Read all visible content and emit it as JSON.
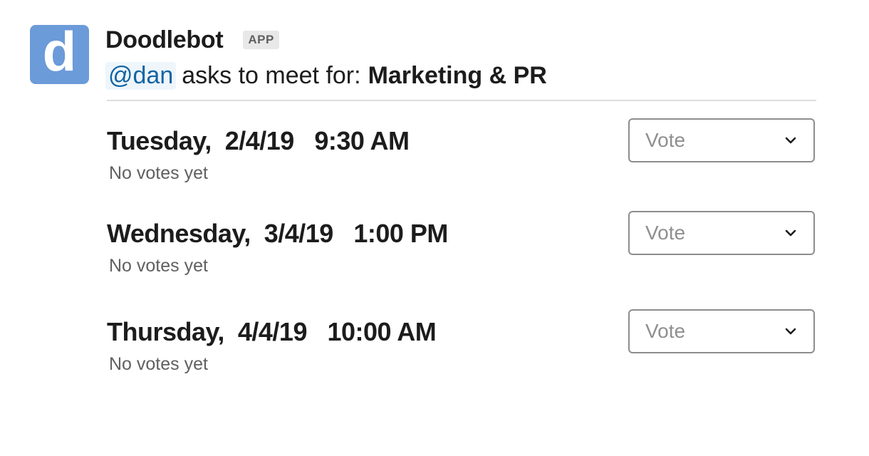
{
  "bot": {
    "avatar_letter": "d",
    "avatar_color": "#6b9bd8",
    "name": "Doodlebot",
    "badge": "APP"
  },
  "message": {
    "mention": "@dan",
    "text": "asks to meet for:",
    "meeting_title": "Marketing & PR"
  },
  "options": [
    {
      "datetime": "Tuesday,  2/4/19   9:30 AM",
      "status": "No votes yet",
      "select_placeholder": "Vote",
      "select_icon": "chevron-down-icon"
    },
    {
      "datetime": "Wednesday,  3/4/19   1:00 PM",
      "status": "No votes yet",
      "select_placeholder": "Vote",
      "select_icon": "chevron-down-icon"
    },
    {
      "datetime": "Thursday,  4/4/19   10:00 AM",
      "status": "No votes yet",
      "select_placeholder": "Vote",
      "select_icon": "chevron-down-icon"
    }
  ],
  "colors": {
    "mention_text": "#1264a3",
    "mention_bg": "#eef6fc",
    "muted_text": "#616061"
  }
}
